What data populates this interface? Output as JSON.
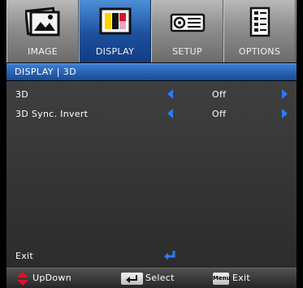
{
  "tabs": [
    {
      "label": "IMAGE",
      "icon": "image-icon",
      "active": false
    },
    {
      "label": "DISPLAY",
      "icon": "display-icon",
      "active": true
    },
    {
      "label": "SETUP",
      "icon": "projector-icon",
      "active": false
    },
    {
      "label": "OPTIONS",
      "icon": "options-icon",
      "active": false
    }
  ],
  "breadcrumb": "DISPLAY | 3D",
  "menu": {
    "rows": [
      {
        "label": "3D",
        "value": "Off"
      },
      {
        "label": "3D Sync. Invert",
        "value": "Off"
      }
    ],
    "exit_label": "Exit"
  },
  "help": {
    "updown_label": "UpDown",
    "select_label": "Select",
    "menu_key_label": "Menu",
    "exit_label": "Exit"
  },
  "colors": {
    "accent_blue": "#2a7bff",
    "active_tab": "#1c4f9c",
    "updown_key": "#e0102a"
  }
}
